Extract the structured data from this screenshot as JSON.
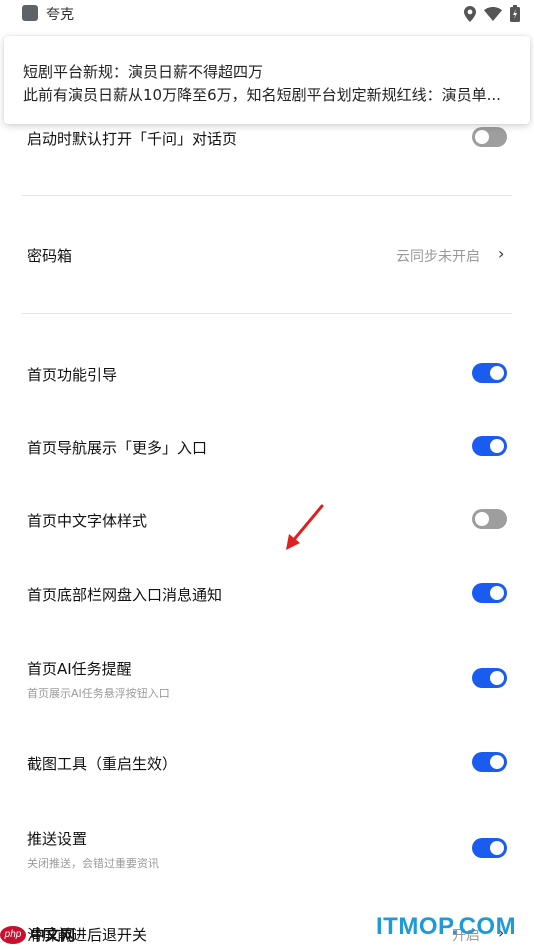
{
  "status_bar": {
    "app_name": "夸克",
    "icons": [
      "location-icon",
      "wifi-icon",
      "battery-icon"
    ]
  },
  "notification": {
    "title": "短剧平台新规：演员日薪不得超四万",
    "text": "此前有演员日薪从10万降至6万，知名短剧平台划定新规红线：演员单..."
  },
  "settings": {
    "startup_qianwen": {
      "label": "启动时默认打开「千问」对话页",
      "enabled": false
    },
    "password_box": {
      "label": "密码箱",
      "value": "云同步未开启"
    },
    "home_guide": {
      "label": "首页功能引导",
      "enabled": true
    },
    "home_more": {
      "label": "首页导航展示「更多」入口",
      "enabled": true
    },
    "home_font": {
      "label": "首页中文字体样式",
      "enabled": false
    },
    "home_netdisk": {
      "label": "首页底部栏网盘入口消息通知",
      "enabled": true
    },
    "home_ai_task": {
      "label": "首页AI任务提醒",
      "subtitle": "首页展示AI任务悬浮按钮入口",
      "enabled": true
    },
    "screenshot_tool": {
      "label": "截图工具（重启生效）",
      "enabled": true
    },
    "push": {
      "label": "推送设置",
      "subtitle": "关闭推送，会错过重要资讯",
      "enabled": true
    },
    "swipe_nav": {
      "label": "滑屏前进后退开关",
      "value": "开启"
    }
  },
  "colors": {
    "toggle_on": "#1a5cf0",
    "toggle_off": "#9e9e9e",
    "annotation_arrow": "#e02020"
  },
  "watermarks": {
    "left_badge": "php",
    "left_text": "中文网",
    "right_text": "ITMOP.COM"
  }
}
